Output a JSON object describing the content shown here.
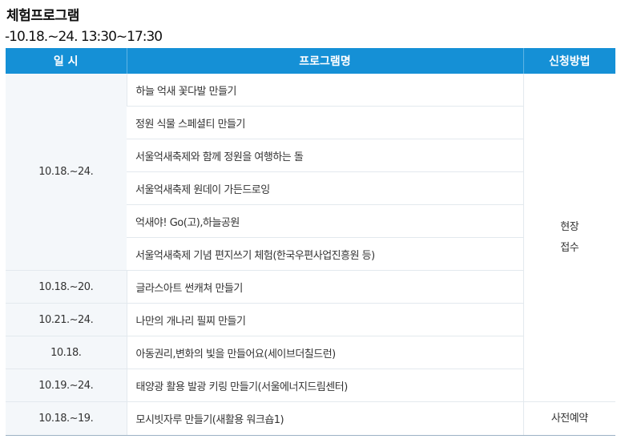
{
  "title": "체험프로그램",
  "subtitle": "-10.18.~24. 13:30~17:30",
  "headers": {
    "date": "일 시",
    "program": "프로그램명",
    "method": "신청방법"
  },
  "rows": [
    {
      "date": "10.18.~24.",
      "program": "하늘 억새 꽃다발 만들기",
      "method_line1": "현장",
      "method_line2": "접수"
    },
    {
      "program": "정원 식물 스페셜티 만들기"
    },
    {
      "program": "서울억새축제와 함께 정원을 여행하는 돌"
    },
    {
      "program": "서울억새축제 원데이 가든드로잉"
    },
    {
      "program": "억새야! Go(고),하늘공원"
    },
    {
      "program": "서울억새축제 기념 편지쓰기 체험(한국우편사업진흥원 등)"
    },
    {
      "date": "10.18.~20.",
      "program": "글라스아트 썬캐쳐 만들기"
    },
    {
      "date": "10.21.~24.",
      "program": "나만의 개나리 필찌 만들기"
    },
    {
      "date": "10.18.",
      "program": "아동권리,변화의 빛을 만들어요(세이브더칠드런)"
    },
    {
      "date": "10.19.~24.",
      "program": "태양광 활용 발광 키링 만들기(서울에너지드림센터)"
    },
    {
      "date": "10.18.~19.",
      "program": "모시빗자루 만들기(새활용 워크숍1)",
      "method": "사전예약"
    }
  ]
}
